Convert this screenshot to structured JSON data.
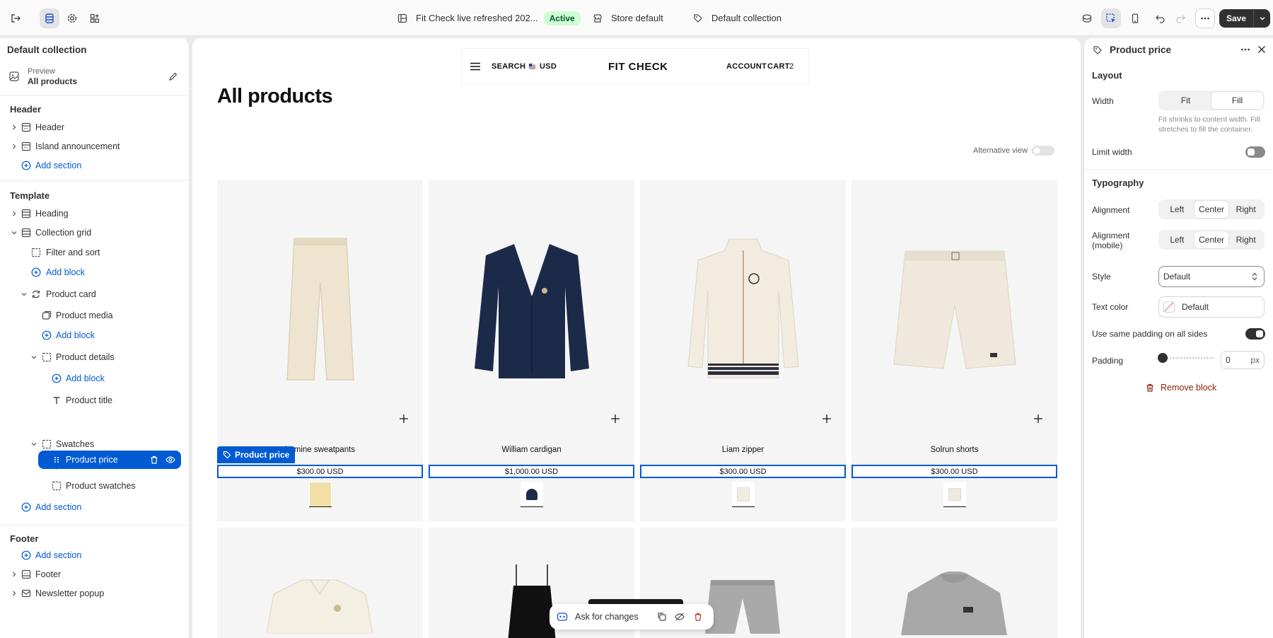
{
  "topbar": {
    "theme_name": "Fit Check live refreshed 202...",
    "status": "Active",
    "store": "Store default",
    "template": "Default collection",
    "save_label": "Save"
  },
  "left": {
    "title": "Default collection",
    "preview_label": "Preview",
    "preview_value": "All products",
    "groups": {
      "header": "Header",
      "template": "Template",
      "footer": "Footer"
    },
    "rows": {
      "header": "Header",
      "island": "Island announcement",
      "add_section": "Add section",
      "heading": "Heading",
      "collection_grid": "Collection grid",
      "filter_sort": "Filter and sort",
      "add_block": "Add block",
      "product_card": "Product card",
      "product_media": "Product media",
      "product_details": "Product details",
      "product_title": "Product title",
      "product_price": "Product price",
      "swatches": "Swatches",
      "product_swatches": "Product swatches",
      "footer": "Footer",
      "newsletter": "Newsletter popup"
    }
  },
  "store": {
    "search": "SEARCH",
    "currency": "USD",
    "brand": "FIT CHECK",
    "account": "ACCOUNT",
    "cart": "CART",
    "cart_count": "2",
    "heading": "All products",
    "alt_view": "Alternative view",
    "selected_block_label": "Product price",
    "ask": "Ask for changes"
  },
  "products": [
    {
      "name": "Lamine sweatpants",
      "price": "$300.00 USD",
      "color": "#eee4cf",
      "swatch": "#f1dfa6"
    },
    {
      "name": "William cardigan",
      "price": "$1,000.00 USD",
      "color": "#1c2a4a",
      "swatch": "#1c2a4a"
    },
    {
      "name": "Liam zipper",
      "price": "$300.00 USD",
      "color": "#f2ece0",
      "swatch": "#f2ece0"
    },
    {
      "name": "Solrun shorts",
      "price": "$300.00 USD",
      "color": "#efe8dc",
      "swatch": "#efe8dc"
    }
  ],
  "right": {
    "title": "Product price",
    "layout": "Layout",
    "width": "Width",
    "fit": "Fit",
    "fill": "Fill",
    "help": "Fit shrinks to content width. Fill stretches to fill the container.",
    "limit_width": "Limit width",
    "typography": "Typography",
    "alignment": "Alignment",
    "alignment_mobile": "Alignment (mobile)",
    "left": "Left",
    "center": "Center",
    "right_opt": "Right",
    "style": "Style",
    "style_value": "Default",
    "text_color": "Text color",
    "text_color_value": "Default",
    "same_padding": "Use same padding on all sides",
    "padding": "Padding",
    "padding_value": "0",
    "padding_unit": "px",
    "remove": "Remove block"
  },
  "colors": {
    "accent": "#005bd3",
    "danger": "#8e1f0b",
    "active_badge": "#cdfed4"
  }
}
